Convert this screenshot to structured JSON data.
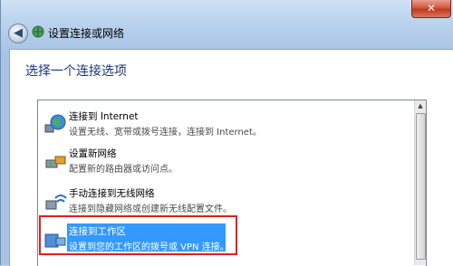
{
  "window": {
    "title": "设置连接或网络",
    "close_label": "✕",
    "back_label": "◀"
  },
  "heading": "选择一个连接选项",
  "options": [
    {
      "title": "连接到 Internet",
      "description": "设置无线、宽带或拨号连接，连接到 Internet。",
      "icon": "globe-network-icon"
    },
    {
      "title": "设置新网络",
      "description": "配置新的路由器或访问点。",
      "icon": "router-icon"
    },
    {
      "title": "手动连接到无线网络",
      "description": "连接到隐藏网络或创建新无线配置文件。",
      "icon": "wireless-icon"
    },
    {
      "title": "连接到工作区",
      "description": "设置到您的工作区的拨号或 VPN 连接。",
      "icon": "workplace-icon",
      "selected": true
    }
  ],
  "colors": {
    "selection": "#3399ff",
    "heading": "#1e3287",
    "annotation_box": "#e0201b"
  }
}
